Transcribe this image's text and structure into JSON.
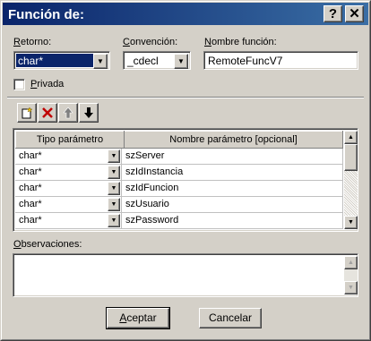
{
  "window": {
    "title": "Función de:",
    "help_label": "?",
    "close_label": "✕"
  },
  "retorno": {
    "label_u": "R",
    "label_rest": "etorno:",
    "value": "char*"
  },
  "convencion": {
    "label_u": "C",
    "label_rest": "onvención:",
    "value": "_cdecl"
  },
  "nombre": {
    "label_u": "N",
    "label_rest": "ombre función:",
    "value": "RemoteFuncV7"
  },
  "privada": {
    "label_u": "P",
    "label_rest": "rivada",
    "checked": false
  },
  "toolbar": {
    "new_icon": "new-row-icon",
    "delete_icon": "delete-icon",
    "up_icon": "arrow-up-icon",
    "down_icon": "arrow-down-icon"
  },
  "grid": {
    "col_type": "Tipo parámetro",
    "col_name": "Nombre parámetro [opcional]",
    "rows": [
      {
        "type": "char*",
        "name": "szServer"
      },
      {
        "type": "char*",
        "name": "szIdInstancia"
      },
      {
        "type": "char*",
        "name": "szIdFuncion"
      },
      {
        "type": "char*",
        "name": "szUsuario"
      },
      {
        "type": "char*",
        "name": "szPassword"
      }
    ]
  },
  "observaciones": {
    "label_u": "O",
    "label_rest": "bservaciones:",
    "value": ""
  },
  "buttons": {
    "accept_u": "A",
    "accept_rest": "ceptar",
    "cancel": "Cancelar"
  }
}
